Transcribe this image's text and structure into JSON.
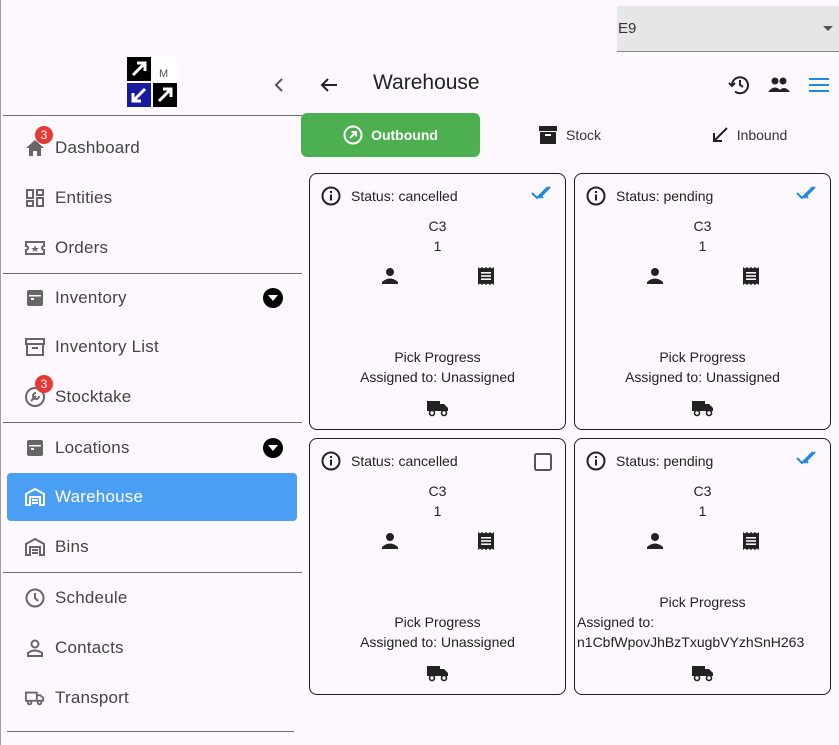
{
  "colors": {
    "accent": "#4a9ff5",
    "outbound_tab": "#4caf50",
    "badge": "#e53935",
    "check": "#1e88e5"
  },
  "top_select": {
    "value": "E9"
  },
  "header": {
    "title": "Warehouse",
    "icons": [
      "history-icon",
      "people-icon",
      "menu-icon"
    ]
  },
  "sidebar": {
    "items": [
      {
        "label": "Dashboard",
        "icon": "home-icon",
        "badge": "3"
      },
      {
        "label": "Entities",
        "icon": "dashboard-icon"
      },
      {
        "label": "Orders",
        "icon": "ticket-icon"
      },
      {
        "label": "Inventory",
        "icon": "inventory-icon"
      },
      {
        "label": "Inventory List",
        "icon": "archive-icon"
      },
      {
        "label": "Stocktake",
        "icon": "wrench-icon",
        "badge": "3"
      },
      {
        "label": "Locations",
        "icon": "inventory-icon"
      },
      {
        "label": "Warehouse",
        "icon": "warehouse-icon",
        "active": true
      },
      {
        "label": "Bins",
        "icon": "warehouse-icon"
      },
      {
        "label": "Schdeule",
        "icon": "clock-icon"
      },
      {
        "label": "Contacts",
        "icon": "person-icon"
      },
      {
        "label": "Transport",
        "icon": "truck-icon"
      }
    ]
  },
  "tabs": [
    {
      "label": "Outbound",
      "icon": "outbound-icon",
      "active": true
    },
    {
      "label": "Stock",
      "icon": "archive-icon"
    },
    {
      "label": "Inbound",
      "icon": "inbound-icon"
    }
  ],
  "cards": [
    {
      "status": "Status: cancelled",
      "checked": true,
      "code": "C3",
      "qty": "1",
      "progress": "Pick Progress",
      "assigned": "Assigned to: Unassigned"
    },
    {
      "status": "Status: pending",
      "checked": true,
      "code": "C3",
      "qty": "1",
      "progress": "Pick Progress",
      "assigned": "Assigned to: Unassigned"
    },
    {
      "status": "Status: cancelled",
      "checked": false,
      "code": "C3",
      "qty": "1",
      "progress": "Pick Progress",
      "assigned": "Assigned to: Unassigned"
    },
    {
      "status": "Status: pending",
      "checked": true,
      "code": "C3",
      "qty": "1",
      "progress": "Pick Progress",
      "assigned_label": "Assigned to:",
      "assigned_value": "n1CbfWpovJhBzTxugbVYzhSnH263"
    }
  ]
}
